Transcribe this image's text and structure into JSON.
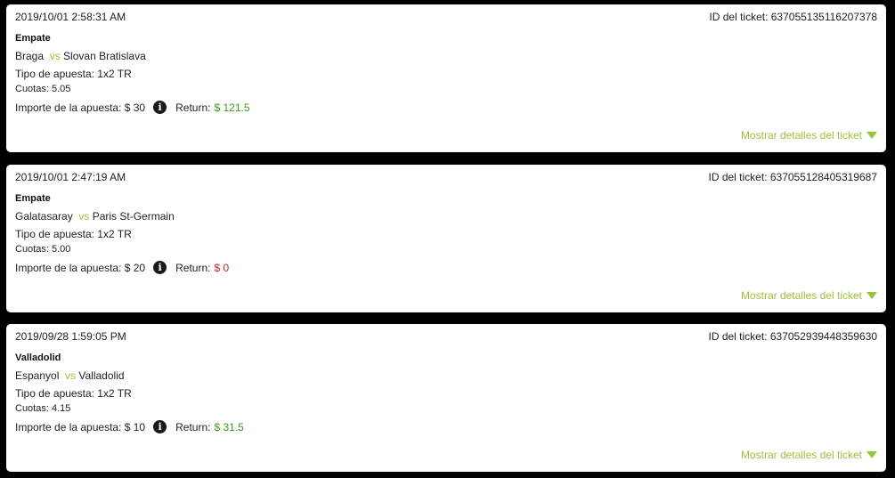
{
  "labels": {
    "ticket_id_prefix": "ID del ticket: ",
    "bet_type_prefix": "Tipo de apuesta: ",
    "odds_prefix": "Cuotas: ",
    "amount_prefix": "Importe de la apuesta: $ ",
    "return_label": "Return:",
    "vs": "vs",
    "details_link": "Mostrar detalles del ticket"
  },
  "colors": {
    "accent_green": "#9bc43a",
    "win_green": "#3a9a1a",
    "loss_red": "#d62020"
  },
  "tickets": [
    {
      "date": "2019/10/01 2:58:31 AM",
      "ticket_id": "637055135116207378",
      "market": "Empate",
      "home": "Braga",
      "away": "Slovan Bratislava",
      "bet_type": "1x2 TR",
      "odds": "5.05",
      "amount": "30",
      "return": "$ 121.5",
      "status": "win"
    },
    {
      "date": "2019/10/01 2:47:19 AM",
      "ticket_id": "637055128405319687",
      "market": "Empate",
      "home": "Galatasaray",
      "away": "Paris St-Germain",
      "bet_type": "1x2 TR",
      "odds": "5.00",
      "amount": "20",
      "return": "$ 0",
      "status": "lose"
    },
    {
      "date": "2019/09/28 1:59:05 PM",
      "ticket_id": "637052939448359630",
      "market": "Valladolid",
      "home": "Espanyol",
      "away": "Valladolid",
      "bet_type": "1x2 TR",
      "odds": "4.15",
      "amount": "10",
      "return": "$ 31.5",
      "status": "win"
    }
  ]
}
